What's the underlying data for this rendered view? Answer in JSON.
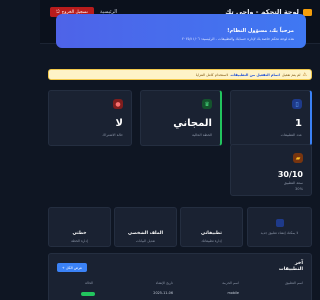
{
  "header": {
    "brand": "لوحة التحكم - واحي تك",
    "nav_link": "الرئيسية",
    "logout": "تسجيل الخروج"
  },
  "hero": {
    "title": "مرحباً بك، مسؤول النظام!",
    "subtitle": "هذه لوحة تحكم خاصة بك لإدارة حسابك والتطبيقات - الرئيسية: ٢٠٢٥/١١/٠٦"
  },
  "alert": {
    "text": "لم يتم تفعيل",
    "link": "اتمام التفعيل من التطبيقات",
    "tail": "لاستخدام كامل المزايا"
  },
  "stats": [
    {
      "value": "1",
      "label": "عدد التطبيقات",
      "icon": "phone-icon",
      "color": "#3b82f6"
    },
    {
      "value": "المجاني",
      "label": "الخطة الحالية",
      "icon": "crown-icon",
      "color": "#22c55e"
    },
    {
      "value": "لا",
      "label": "حالة الاشتراك",
      "icon": "circle-icon",
      "color": "#ef4444"
    }
  ],
  "usage": {
    "value": "30/10",
    "label": "سعة التطبيق",
    "sub": "30%",
    "icon": "folder-icon",
    "color": "#f59e0b"
  },
  "features": [
    {
      "title": "",
      "sub": "لا يمكنك إنشاء تطبيق جديد",
      "icon": "add-icon",
      "color": "#3b82f6"
    },
    {
      "title": "تطبيقاتي",
      "sub": "إدارة تطبيقاتك",
      "icon": "apps-icon",
      "color": "#6366f1"
    },
    {
      "title": "الملف الشخصي",
      "sub": "تعديل البيانات",
      "icon": "user-icon",
      "color": "#14b8a6"
    },
    {
      "title": "خطتي",
      "sub": "إدارة الخطة",
      "icon": "plan-icon",
      "color": "#a855f7"
    }
  ],
  "apps": {
    "title": "آخر التطبيقات",
    "button": "عرض الكل +",
    "columns": [
      "اسم التطبيق",
      "اسم الحزمة",
      "تاريخ الإنشاء",
      "الحالة"
    ],
    "rows": [
      {
        "name": "",
        "package": "mobile",
        "date": "2025-11-06",
        "status": ""
      }
    ]
  }
}
